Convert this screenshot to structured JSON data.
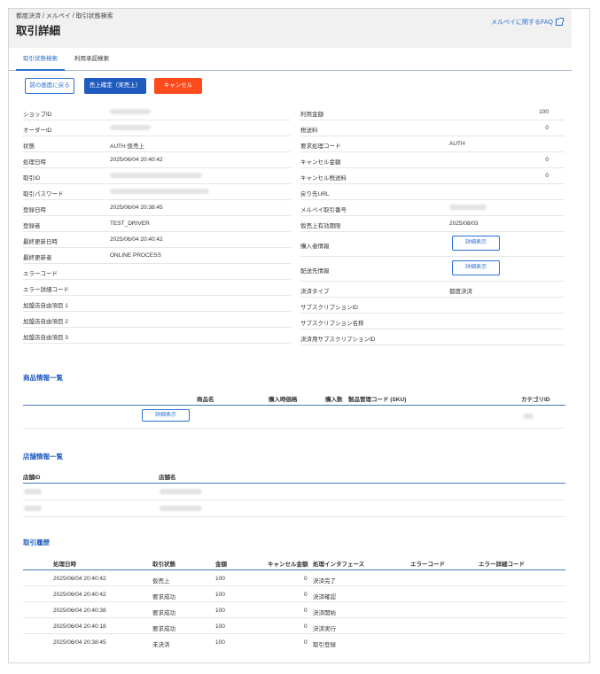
{
  "header": {
    "breadcrumb": "都度決済 / メルペイ / 取引状態検索",
    "title": "取引詳細",
    "faq_link": "メルペイに関するFAQ"
  },
  "tabs": [
    {
      "label": "取引状態検索"
    },
    {
      "label": "利用承認検索"
    }
  ],
  "actions": {
    "back": "前の画面に戻る",
    "confirm": "売上確定（実売上）",
    "cancel": "キャンセル"
  },
  "left_fields": [
    {
      "label": "ショップID",
      "value": ""
    },
    {
      "label": "オーダーID",
      "value": ""
    },
    {
      "label": "状態",
      "value": "AUTH 仮売上"
    },
    {
      "label": "処理日時",
      "value": "2025/06/04 20:40:42"
    },
    {
      "label": "取引ID",
      "value": ""
    },
    {
      "label": "取引パスワード",
      "value": ""
    },
    {
      "label": "登録日時",
      "value": "2025/06/04 20:38:45"
    },
    {
      "label": "登録者",
      "value": "TEST_DRIVER"
    },
    {
      "label": "最終更新日時",
      "value": "2025/06/04 20:40:42"
    },
    {
      "label": "最終更新者",
      "value": "ONLINE PROCESS"
    },
    {
      "label": "エラーコード",
      "value": ""
    },
    {
      "label": "エラー詳細コード",
      "value": ""
    },
    {
      "label": "加盟店自由項目 1",
      "value": ""
    },
    {
      "label": "加盟店自由項目 2",
      "value": ""
    },
    {
      "label": "加盟店自由項目 3",
      "value": ""
    }
  ],
  "right_fields": [
    {
      "label": "利用金額",
      "value": "100"
    },
    {
      "label": "税送料",
      "value": "0"
    },
    {
      "label": "要求処理コード",
      "value": "AUTH"
    },
    {
      "label": "キャンセル金額",
      "value": "0"
    },
    {
      "label": "キャンセル税送料",
      "value": "0"
    },
    {
      "label": "戻り先URL",
      "value": ""
    },
    {
      "label": "メルペイ取引番号",
      "value": ""
    },
    {
      "label": "仮売上有効期限",
      "value": "2025/08/03"
    },
    {
      "label": "購入者情報",
      "value": "詳細表示"
    },
    {
      "label": "配送先情報",
      "value": "詳細表示"
    },
    {
      "label": "決済タイプ",
      "value": "都度決済"
    },
    {
      "label": "サブスクリプションID",
      "value": ""
    },
    {
      "label": "サブスクリプション名称",
      "value": ""
    },
    {
      "label": "決済用サブスクリプションID",
      "value": ""
    }
  ],
  "products": {
    "title": "商品情報一覧",
    "headers": [
      "商品名",
      "購入時価格",
      "購入数",
      "製品管理コード (SKU)",
      "カテゴリID"
    ],
    "detail_button": "詳細表示"
  },
  "stores": {
    "title": "店舗情報一覧",
    "headers": [
      "店舗ID",
      "店舗名"
    ]
  },
  "history": {
    "title": "取引履歴",
    "headers": [
      "処理日時",
      "取引状態",
      "金額",
      "キャンセル金額",
      "処理インタフェース",
      "エラーコード",
      "エラー詳細コード"
    ],
    "rows": [
      {
        "datetime": "2025/06/04 20:40:42",
        "status": "仮売上",
        "amount": "100",
        "cancel": "0",
        "iface": "決済完了"
      },
      {
        "datetime": "2025/06/04 20:40:42",
        "status": "要求成功",
        "amount": "100",
        "cancel": "0",
        "iface": "決済確認"
      },
      {
        "datetime": "2025/06/04 20:40:38",
        "status": "要求成功",
        "amount": "100",
        "cancel": "0",
        "iface": "決済開始"
      },
      {
        "datetime": "2025/06/04 20:40:18",
        "status": "要求成功",
        "amount": "100",
        "cancel": "0",
        "iface": "決済実行"
      },
      {
        "datetime": "2025/06/04 20:38:45",
        "status": "未決済",
        "amount": "100",
        "cancel": "0",
        "iface": "取引登録"
      }
    ]
  },
  "colors": {
    "accent": "#2a6fd0",
    "primary_button": "#1f5bbf",
    "danger_button": "#ff4a1c",
    "header_bg": "#f1f1f1"
  }
}
